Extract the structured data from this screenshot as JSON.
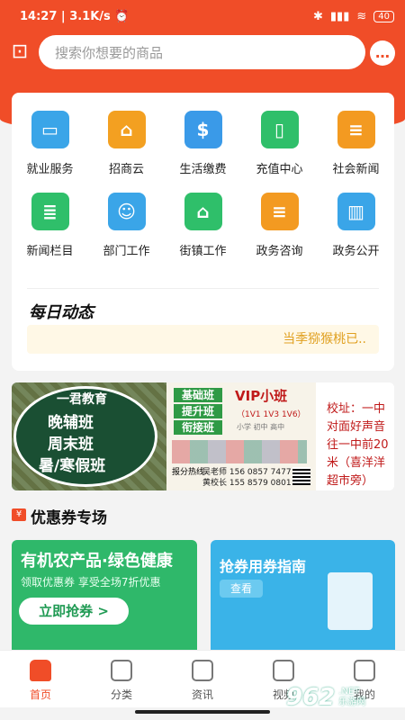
{
  "status": {
    "time": "14:27",
    "speed": "3.1K/s",
    "battery": "40"
  },
  "search": {
    "placeholder": "搜索你想要的商品"
  },
  "services": [
    {
      "label": "就业服务",
      "icon": "briefcase-icon",
      "color": "#3aa5e8"
    },
    {
      "label": "招商云",
      "icon": "store-icon",
      "color": "#f3a021"
    },
    {
      "label": "生活缴费",
      "icon": "water-drop-icon",
      "color": "#3a9ae8"
    },
    {
      "label": "充值中心",
      "icon": "phone-icon",
      "color": "#2fbf6a"
    },
    {
      "label": "社会新闻",
      "icon": "document-icon",
      "color": "#f39a21"
    },
    {
      "label": "新闻栏目",
      "icon": "news-icon",
      "color": "#2fbf6a"
    },
    {
      "label": "部门工作",
      "icon": "person-card-icon",
      "color": "#3aa5e8"
    },
    {
      "label": "街镇工作",
      "icon": "house-icon",
      "color": "#2fbf6a"
    },
    {
      "label": "政务咨询",
      "icon": "file-icon",
      "color": "#f39a21"
    },
    {
      "label": "政务公开",
      "icon": "book-icon",
      "color": "#3aa5e8"
    }
  ],
  "daily": {
    "title": "每日动态",
    "ticker": "当季猕猴桃已.."
  },
  "banner": {
    "school": "一君教育",
    "lines": [
      "晚辅班",
      "周末班",
      "暑/寒假班"
    ],
    "tags": [
      "基础班",
      "提升班",
      "衔接班"
    ],
    "vip": "VIP小班",
    "vip_sub": "（1V1 1V3 1V6）",
    "grades": "小学 初中 高中",
    "hotline_label": "报分热线",
    "phones": "吴老师 156 0857 7477",
    "phones2": "黄校长 155 8579 0801",
    "address": "校址：一中对面好声音往一中前20米（喜洋洋超市旁）"
  },
  "coupon": {
    "section_title": "优惠券专场",
    "card1_title": "有机农产品·绿色健康",
    "card1_sub": "领取优惠券 享受全场7折优惠",
    "card1_button": "立即抢券 >",
    "card2_title": "抢券用券指南",
    "card2_button": "查看"
  },
  "tabs": [
    {
      "label": "首页",
      "icon": "home-icon"
    },
    {
      "label": "分类",
      "icon": "category-icon"
    },
    {
      "label": "资讯",
      "icon": "news-icon"
    },
    {
      "label": "视频",
      "icon": "video-icon"
    },
    {
      "label": "我的",
      "icon": "user-icon"
    }
  ],
  "watermark": {
    "brand": "962",
    "net": ".NET",
    "site": "乐游网"
  }
}
